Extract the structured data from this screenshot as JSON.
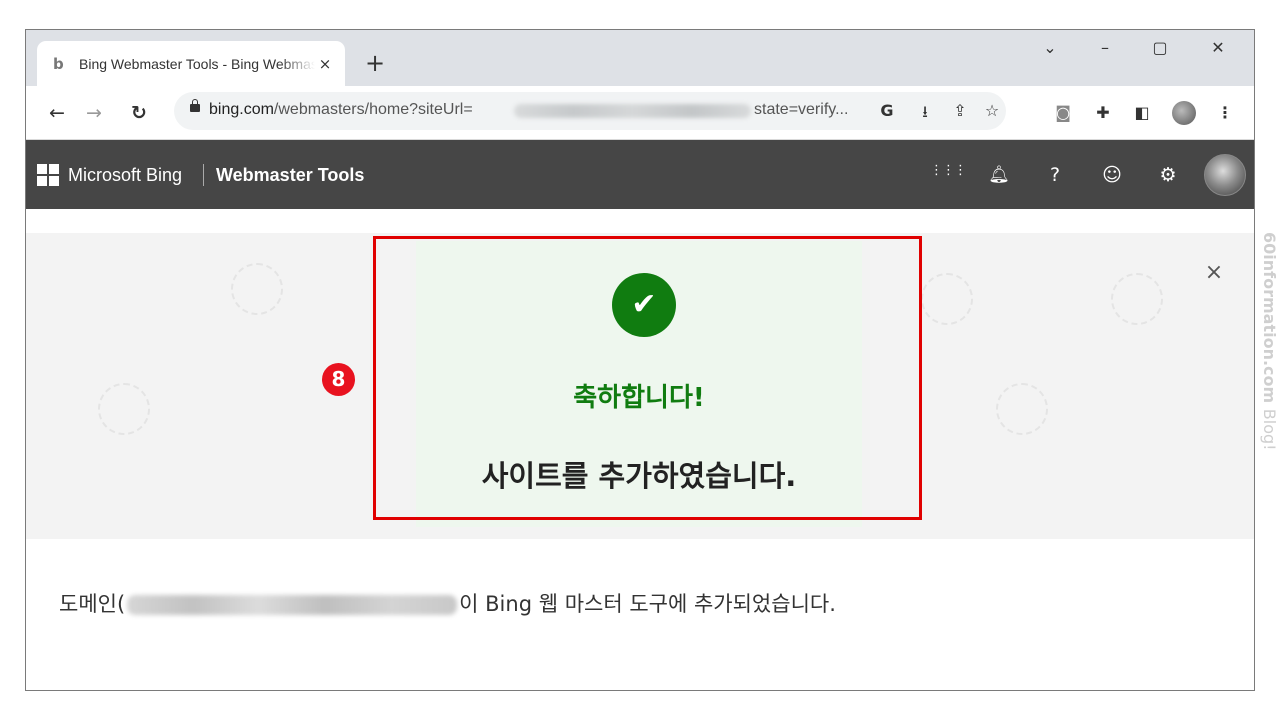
{
  "browser": {
    "tab": {
      "favicon": "bing-icon",
      "title": "Bing Webmaster Tools - Bing Webmaster Tools",
      "close": "×"
    },
    "new_tab": "+",
    "window_controls": {
      "tabsearch": "⌄",
      "minimize": "–",
      "maximize": "▢",
      "close": "✕"
    },
    "nav": {
      "back": "←",
      "forward": "→",
      "reload": "↻"
    },
    "url_host": "bing.com",
    "url_path": "/webmasters/home?siteUrl=",
    "url_tail": "state=verify...",
    "omnibox_icons": {
      "google": "G",
      "install": "⭳",
      "share": "⇪",
      "bookmark": "☆"
    },
    "extensions": {
      "camera": "◙",
      "puzzle": "✚",
      "sidepanel": "◧",
      "menu": "⋮"
    }
  },
  "header": {
    "brand": "Microsoft Bing",
    "product": "Webmaster Tools",
    "icons": {
      "apps": "⋮⋮⋮",
      "notifications": "🔔︎",
      "help": "?",
      "feedback": "☺",
      "settings": "⚙"
    }
  },
  "banner": {
    "check_glyph": "✔",
    "congrats": "축하합니다!",
    "message": "사이트를 추가하였습니다.",
    "close": "×"
  },
  "step_badge": "8",
  "domain_line": {
    "prefix": "도메인(",
    "suffix": "이 Bing 웹 마스터 도구에 추가되었습니다."
  },
  "side_watermark": {
    "site": "60information.com",
    "blog": "Blog!"
  },
  "colors": {
    "success": "#107c10",
    "highlight": "#e00000",
    "badge": "#e8121f",
    "header_bg": "#464646"
  }
}
